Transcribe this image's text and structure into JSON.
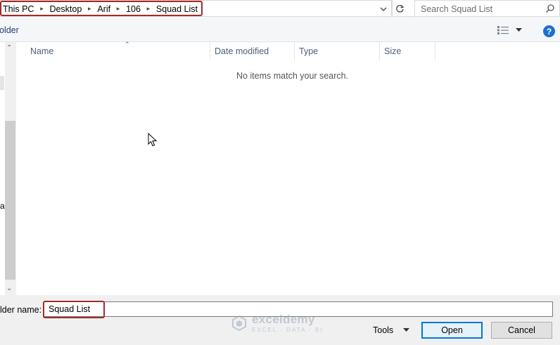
{
  "address_bar": {
    "crumbs": [
      "This PC",
      "Desktop",
      "Arif",
      "106",
      "Squad List"
    ]
  },
  "search": {
    "placeholder": "Search Squad List"
  },
  "toolbar": {
    "new_folder_label": "older",
    "help_label": "?"
  },
  "nav": {
    "partial_item": "a"
  },
  "file_list": {
    "columns": [
      "Name",
      "Date modified",
      "Type",
      "Size"
    ],
    "empty_message": "No items match your search."
  },
  "bottom": {
    "folder_name_label": "lder name:",
    "folder_name_value": "Squad List",
    "tools_label": "Tools",
    "open_label": "Open",
    "cancel_label": "Cancel"
  },
  "watermark": {
    "brand": "exceldemy",
    "tagline": "EXCEL · DATA · BI"
  },
  "colors": {
    "highlight": "#a52a2a",
    "accent": "#0078d7",
    "help": "#1e6fd0"
  },
  "icons": [
    "chevron-right-icon",
    "chevron-down-icon",
    "refresh-icon",
    "search-icon",
    "view-details-icon",
    "help-icon",
    "sort-up-icon",
    "mouse-cursor-icon"
  ]
}
